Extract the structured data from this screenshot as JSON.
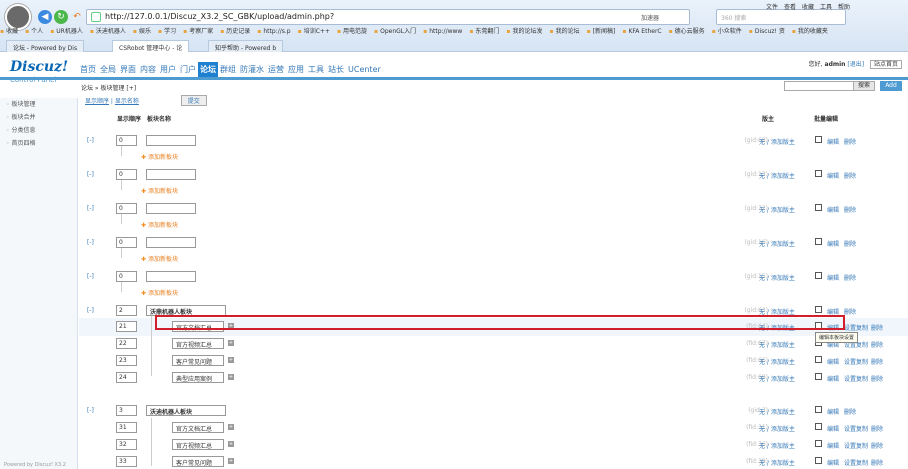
{
  "browser": {
    "menu": [
      "文件",
      "查看",
      "收藏",
      "工具",
      "帮助"
    ],
    "url": "http://127.0.0.1/Discuz_X3.2_SC_GBK/upload/admin.php?",
    "add_label": "加速器",
    "search_placeholder": "360 搜索",
    "bookmarks": [
      "收藏",
      "个人",
      "UR机器人",
      "沃迪机器人",
      "娱乐",
      "学习",
      "考察厂家",
      "历史记录",
      "http://s.p",
      "培训C++",
      "用电范旋",
      "OpenGL入门",
      "http://www",
      "东莞翻门",
      "我的论坛发",
      "我的论坛",
      "[新闻稿]",
      "KFA EtherC",
      "德心云服务",
      "小众软件",
      "Discuz! 资",
      "我的收藏夹"
    ],
    "tabs": [
      "论坛 - Powered by Dis",
      "CSRobot 管理中心 - 论",
      "知乎帮助 - Powered b"
    ]
  },
  "header": {
    "logo": "Discuz!",
    "logo_sub": "Control Panel",
    "nav": [
      "首页",
      "全局",
      "界面",
      "内容",
      "用户",
      "门户",
      "论坛",
      "群组",
      "防灌水",
      "运营",
      "应用",
      "工具",
      "站长",
      "UCenter"
    ],
    "active_nav": "论坛",
    "greeting": "您好,",
    "username": "admin",
    "logout": "[退出]",
    "home_link": "站点首页"
  },
  "breadcrumb": "论坛 » 板块管理 [+]",
  "search_button": "搜索",
  "add_button": "Add",
  "sidebar": [
    "板块管理",
    "板块合并",
    "分类信息",
    "首页四格"
  ],
  "sidebar_footer": "Powered by Discuz! X3.2",
  "subtabs": {
    "a": "显示顺序",
    "b": "显示名称",
    "btn": "提交"
  },
  "table_headers": {
    "order": "显示顺序",
    "name": "板块名称",
    "moderator": "版主",
    "batch": "批量编辑"
  },
  "labels": {
    "expand": "[-]",
    "add_sub": "添加新板块",
    "none": "无",
    "add_mod": "添加版主",
    "edit": "编辑",
    "copy": "设置复制",
    "delete": "删除"
  },
  "rows": [
    {
      "type": "group",
      "order": "0",
      "name": "",
      "gid": "(gid:68)"
    },
    {
      "type": "group",
      "order": "0",
      "name": "",
      "gid": "(gid:13)"
    },
    {
      "type": "group",
      "order": "0",
      "name": "",
      "gid": "(gid:72)"
    },
    {
      "type": "group",
      "order": "0",
      "name": "",
      "gid": "(gid:16)"
    },
    {
      "type": "group",
      "order": "0",
      "name": "",
      "gid": "(gid:15)"
    },
    {
      "type": "group",
      "order": "2",
      "name": "沃鼎机器人板块",
      "gid": "(gid:63)"
    },
    {
      "type": "forum",
      "order": "21",
      "name": "官方文档汇总",
      "gid": "(fid:64)"
    },
    {
      "type": "forum",
      "order": "22",
      "name": "官方视频汇总",
      "gid": "(fid:67)"
    },
    {
      "type": "forum",
      "order": "23",
      "name": "客户常见问题",
      "gid": "(fid:66)"
    },
    {
      "type": "forum",
      "order": "24",
      "name": "典型应用案例",
      "gid": "(fid:69)"
    },
    {
      "type": "group",
      "order": "3",
      "name": "沃迪机器人板块",
      "gid": "(gid:3)"
    },
    {
      "type": "forum",
      "order": "31",
      "name": "官方文档汇总",
      "gid": "(fid:31)"
    },
    {
      "type": "forum",
      "order": "32",
      "name": "官方视频汇总",
      "gid": "(fid:36)"
    },
    {
      "type": "forum",
      "order": "33",
      "name": "客户常见问题",
      "gid": "(fid:39)"
    }
  ],
  "tooltip": "编辑本板块设置",
  "colors": {
    "accent": "#1f80d0",
    "highlight": "#d21e2a",
    "link": "#3578b7",
    "add": "#e77e1e"
  }
}
